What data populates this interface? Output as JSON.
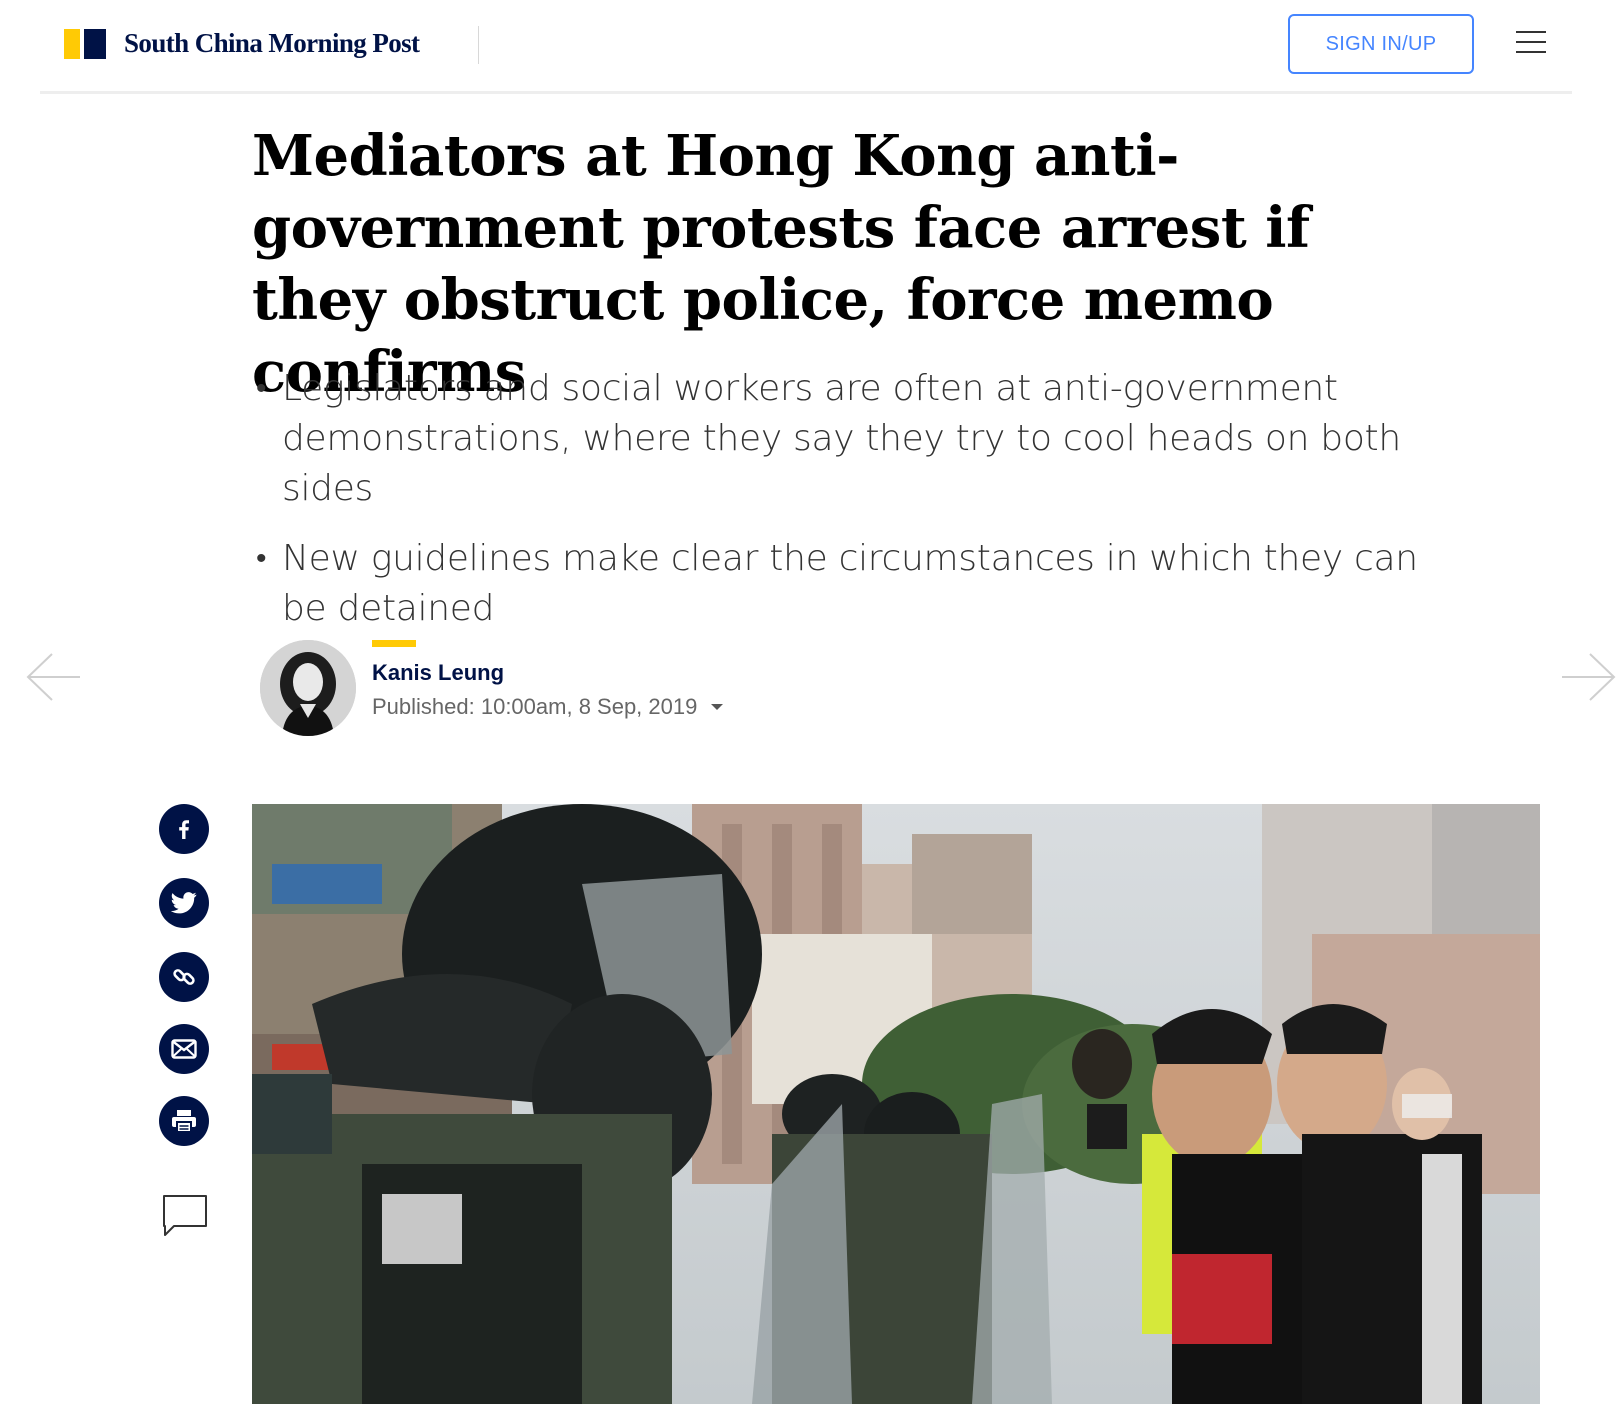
{
  "header": {
    "logo_text": "South China Morning Post",
    "signin_label": "SIGN IN/UP",
    "menu_icon": "hamburger-menu-icon"
  },
  "article": {
    "headline": "Mediators at Hong Kong anti-government protests face arrest if they obstruct police, force memo confirms",
    "summary": [
      "Legislators and social workers are often at anti-government demonstrations, where they say they try to cool heads on both sides",
      "New guidelines make clear the circumstances in which they can be detained"
    ],
    "author": "Kanis Leung",
    "published": "Published: 10:00am, 8 Sep, 2019"
  },
  "share": {
    "icons": [
      "facebook-icon",
      "twitter-icon",
      "link-icon",
      "email-icon",
      "print-icon",
      "comment-icon"
    ]
  },
  "colors": {
    "brand_navy": "#001246",
    "brand_yellow": "#ffca05",
    "signin_blue": "#4585ff"
  }
}
